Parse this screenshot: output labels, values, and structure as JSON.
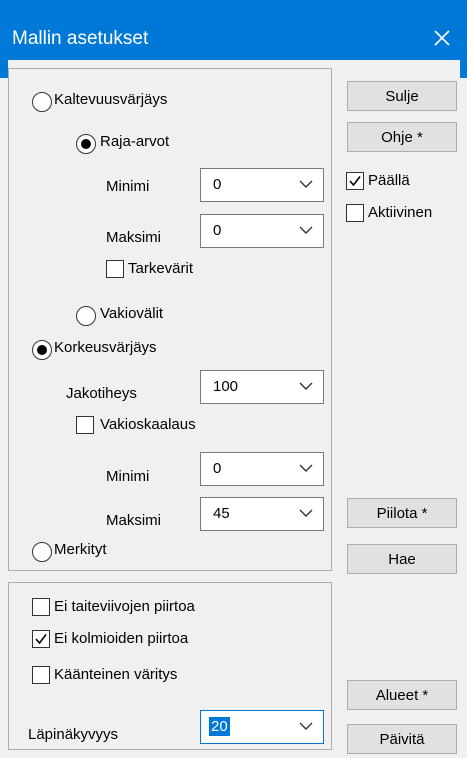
{
  "window": {
    "title": "Mallin asetukset"
  },
  "shading": {
    "slope_label": "Kaltevuusvärjäys",
    "limits_label": "Raja-arvot",
    "slope_min_label": "Minimi",
    "slope_min_value": "0",
    "slope_max_label": "Maksimi",
    "slope_max_value": "0",
    "precise_colors_label": "Tarkevärit",
    "constant_intervals_label": "Vakiovälit",
    "height_label": "Korkeusvärjäys",
    "interval_label": "Jakotiheys",
    "interval_value": "100",
    "constant_scale_label": "Vakioskaalaus",
    "height_min_label": "Minimi",
    "height_min_value": "0",
    "height_max_label": "Maksimi",
    "height_max_value": "45",
    "marked_label": "Merkityt"
  },
  "drawing": {
    "no_breaklines_label": "Ei taiteviivojen piirtoa",
    "no_triangles_label": "Ei kolmioiden piirtoa",
    "inverse_colors_label": "Käänteinen väritys",
    "transparency_label": "Läpinäkyvyys",
    "transparency_value": "20"
  },
  "buttons": {
    "close": "Sulje",
    "help": "Ohje *",
    "on_label": "Päällä",
    "active_label": "Aktiivinen",
    "hide": "Piilota *",
    "fetch": "Hae",
    "areas": "Alueet *",
    "update": "Päivitä"
  },
  "state": {
    "slope_selected": false,
    "limits_selected": true,
    "constant_intervals_selected": false,
    "height_selected": true,
    "marked_selected": false,
    "precise_colors_checked": false,
    "constant_scale_checked": false,
    "no_breaklines_checked": false,
    "no_triangles_checked": true,
    "inverse_colors_checked": false,
    "on_checked": true,
    "active_checked": false
  },
  "colors": {
    "titlebar": "#0078d7",
    "focus": "#0078d7"
  }
}
